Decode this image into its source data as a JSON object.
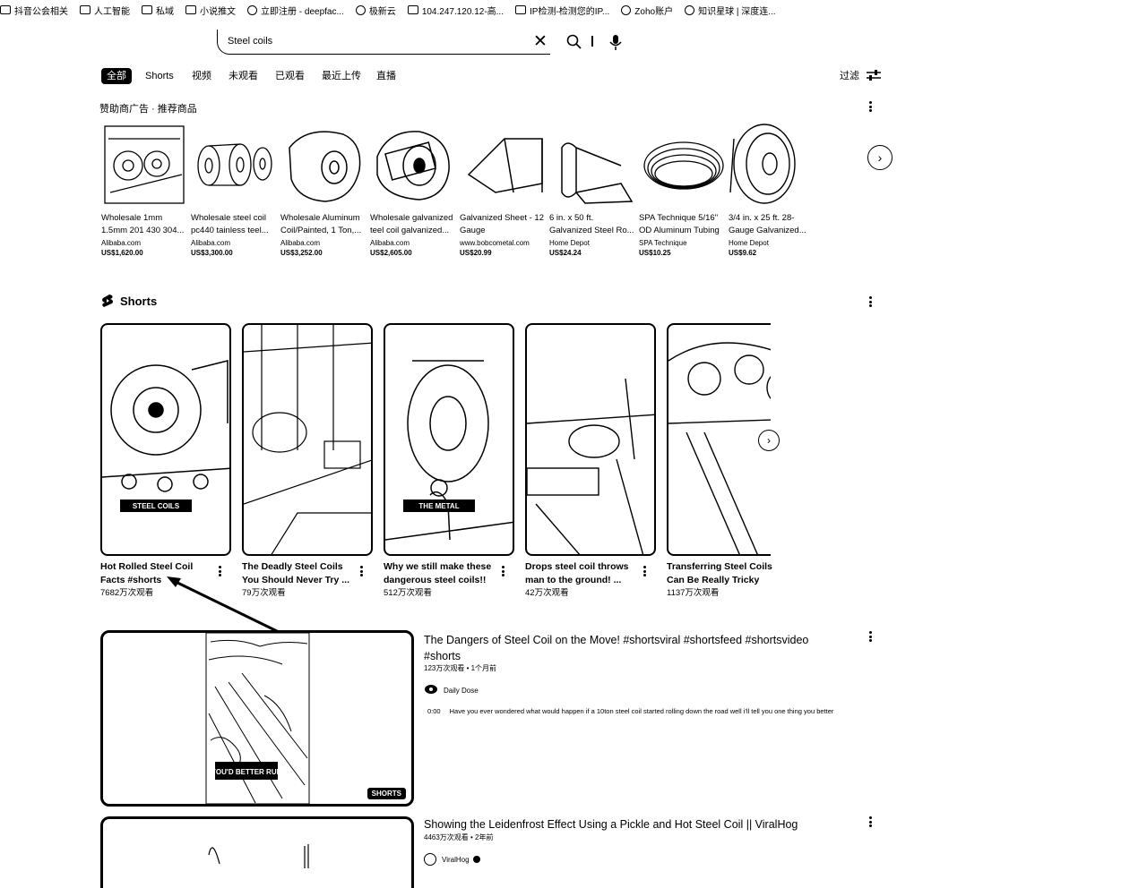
{
  "bookmarks": [
    "抖音公会相关",
    "人工智能",
    "私域",
    "小说推文",
    "立即注册 - deepfac...",
    "极新云",
    "104.247.120.12-高...",
    "IP检测-检测您的IP...",
    "Zoho账户",
    "知识星球 | 深度连..."
  ],
  "search": {
    "query": "Steel coils"
  },
  "chips": [
    "全部",
    "Shorts",
    "视频",
    "未观看",
    "已观看",
    "最近上传",
    "直播"
  ],
  "filter_label": "过滤",
  "sponsored": {
    "header": "赞助商广告 · 推荐商品",
    "products": [
      {
        "title": "Wholesale 1mm 1.5mm 201 430 304...",
        "seller": "Alibaba.com",
        "price": "US$1,620.00"
      },
      {
        "title": "Wholesale steel coil pc440 tainless teel...",
        "seller": "Alibaba.com",
        "price": "US$3,300.00"
      },
      {
        "title": "Wholesale Aluminum Coil/Painted, 1 Ton,...",
        "seller": "Alibaba.com",
        "price": "US$3,252.00"
      },
      {
        "title": "Wholesale galvanized teel coil galvanized...",
        "seller": "Alibaba.com",
        "price": "US$2,605.00"
      },
      {
        "title": "Galvanized Sheet - 12 Gauge",
        "seller": "www.bobcometal.com",
        "price": "US$20.99"
      },
      {
        "title": "6 in. x 50 ft. Galvanized Steel Ro...",
        "seller": "Home Depot",
        "price": "US$24.24"
      },
      {
        "title": "SPA Technique 5/16\" OD Aluminum Tubing",
        "seller": "SPA Technique",
        "price": "US$10.25"
      },
      {
        "title": "3/4 in. x 25 ft. 28-Gauge Galvanized...",
        "seller": "Home Depot",
        "price": "US$9.62"
      }
    ]
  },
  "shorts": {
    "header": "Shorts",
    "items": [
      {
        "title": "Hot Rolled Steel Coil Facts #shorts",
        "views": "7682万次观看",
        "overlay": "STEEL COILS"
      },
      {
        "title": "The Deadly Steel Coils You Should Never Try ...",
        "views": "79万次观看",
        "overlay": ""
      },
      {
        "title": "Why we still make these dangerous steel coils!!",
        "views": "512万次观看",
        "overlay": "THE METAL"
      },
      {
        "title": "Drops steel coil throws man to the ground! ...",
        "views": "42万次观看",
        "overlay": ""
      },
      {
        "title": "Transferring Steel Coils Can Be Really Tricky",
        "views": "1137万次观看",
        "overlay": ""
      }
    ]
  },
  "videos": [
    {
      "title": "The Dangers of Steel Coil on the Move! #shortsviral #shortsfeed #shortsvideo #shorts",
      "meta": "123万次观看 • 1个月前",
      "channel": "Daily Dose",
      "timestamp": "0:00",
      "description": "Have you ever wondered what would happen if a 10ton steel coil started rolling down the road well i'll tell you one thing you better",
      "badge": "SHORTS",
      "overlay": "YOU'D BETTER RUN"
    },
    {
      "title": "Showing the Leidenfrost Effect Using a Pickle and Hot Steel Coil || ViralHog",
      "meta": "4463万次观看 • 2年前",
      "channel": "ViralHog"
    }
  ]
}
